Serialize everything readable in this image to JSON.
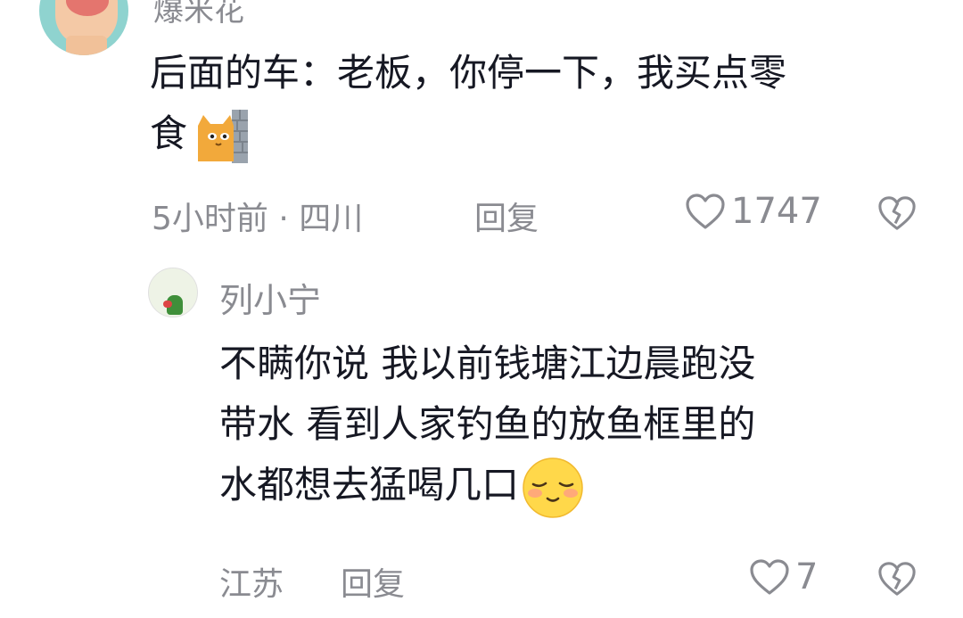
{
  "comment1": {
    "username": "爆米花",
    "text_line1": "后面的车：老板，你停一下，我买点零",
    "text_line2": "食",
    "emoji": "cat-peeking-emoji",
    "meta_time_location": "5小时前 · 四川",
    "reply_label": "回复",
    "like_count": "1747"
  },
  "reply1": {
    "username": "列小宁",
    "text_line1": "不瞒你说 我以前钱塘江边晨跑没",
    "text_line2": "带水 看到人家钓鱼的放鱼框里的",
    "text_line3": "水都想去猛喝几口",
    "emoji": "shy-smile-emoji",
    "meta_location": "江苏",
    "reply_label": "回复",
    "like_count": "7"
  },
  "colors": {
    "primary_text": "#161823",
    "secondary_text": "#8a8b91",
    "background": "#ffffff"
  }
}
